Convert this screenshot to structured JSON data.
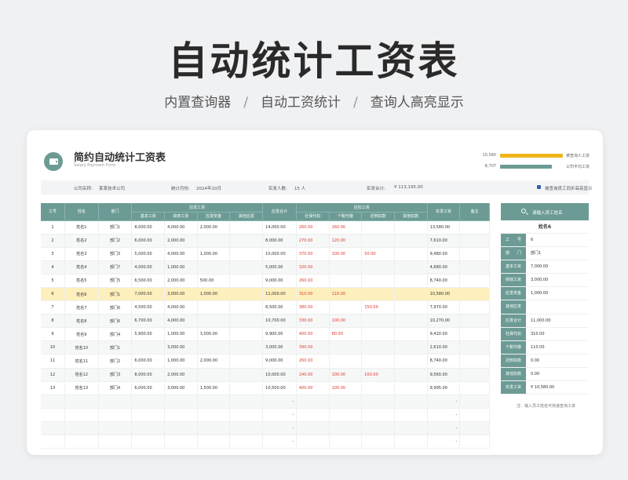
{
  "hero": {
    "title": "自动统计工资表",
    "sub": [
      "内置查询器",
      "/",
      "自动工资统计",
      "/",
      "查询人高亮显示"
    ]
  },
  "form": {
    "title": "简约自动统计工资表",
    "subtitle": "Salary Payment Form"
  },
  "mini_chart": {
    "bars": [
      {
        "value": "10,580",
        "label": "被查询人工资",
        "color": "#f0b51d",
        "fraction": 1.0
      },
      {
        "value": "8,707",
        "label": "公司平均工资",
        "color": "#6c9b95",
        "fraction": 0.82
      }
    ]
  },
  "info": {
    "company_label": "公司名称:",
    "company": "某某技术公司",
    "month_label": "统计月份:",
    "month": "2024年10月",
    "people_label": "实发人数:",
    "people": "15 人",
    "total_label": "实发合计:",
    "total": "¥ 113,195.00",
    "highlight_label": "被查询员工同步高亮显示"
  },
  "table": {
    "headers": {
      "id": "工号",
      "name": "姓名",
      "dept": "部门",
      "pay_group": "应发工资",
      "basic": "基本工资",
      "perf": "绩效工资",
      "bonus": "应发奖金",
      "other_pay": "其他应发",
      "total_pay": "应发合计",
      "deduct_group": "应扣工资",
      "social": "社保代扣",
      "tax": "个税代缴",
      "late": "迟到扣款",
      "other_deduct": "其他扣款",
      "net": "实发工资",
      "remark": "备注"
    },
    "rows": [
      {
        "id": "1",
        "name": "姓名1",
        "dept": "部门1",
        "basic": "8,000.00",
        "perf": "4,000.00",
        "bonus": "2,000.00",
        "other": "",
        "total": "14,000.00",
        "social": "260.00",
        "tax": "160.00",
        "late": "",
        "od": "",
        "net": "13,580.00",
        "remark": ""
      },
      {
        "id": "2",
        "name": "姓名2",
        "dept": "部门2",
        "basic": "6,000.00",
        "perf": "2,000.00",
        "bonus": "",
        "other": "",
        "total": "8,000.00",
        "social": "270.00",
        "tax": "120.00",
        "late": "",
        "od": "",
        "net": "7,610.00",
        "remark": ""
      },
      {
        "id": "3",
        "name": "姓名3",
        "dept": "部门3",
        "basic": "5,000.00",
        "perf": "4,000.00",
        "bonus": "1,000.00",
        "other": "",
        "total": "10,000.00",
        "social": "370.00",
        "tax": "100.00",
        "late": "50.00",
        "od": "",
        "net": "9,480.00",
        "remark": ""
      },
      {
        "id": "4",
        "name": "姓名4",
        "dept": "部门7",
        "basic": "4,000.00",
        "perf": "1,000.00",
        "bonus": "",
        "other": "",
        "total": "5,000.00",
        "social": "320.00",
        "tax": "",
        "late": "",
        "od": "",
        "net": "4,680.00",
        "remark": ""
      },
      {
        "id": "5",
        "name": "姓名5",
        "dept": "部门5",
        "basic": "6,500.00",
        "perf": "2,000.00",
        "bonus": "500.00",
        "other": "",
        "total": "9,000.00",
        "social": "260.00",
        "tax": "",
        "late": "",
        "od": "",
        "net": "8,740.00",
        "remark": ""
      },
      {
        "id": "6",
        "name": "姓名6",
        "dept": "部门1",
        "basic": "7,000.00",
        "perf": "3,000.00",
        "bonus": "1,000.00",
        "other": "",
        "total": "11,000.00",
        "social": "310.00",
        "tax": "110.00",
        "late": "",
        "od": "",
        "net": "10,580.00",
        "remark": ""
      },
      {
        "id": "7",
        "name": "姓名7",
        "dept": "部门6",
        "basic": "4,500.00",
        "perf": "4,000.00",
        "bonus": "",
        "other": "",
        "total": "8,500.00",
        "social": "380.00",
        "tax": "",
        "late": "150.00",
        "od": "",
        "net": "7,970.00",
        "remark": ""
      },
      {
        "id": "8",
        "name": "姓名8",
        "dept": "部门6",
        "basic": "6,700.00",
        "perf": "4,000.00",
        "bonus": "",
        "other": "",
        "total": "10,700.00",
        "social": "330.00",
        "tax": "100.00",
        "late": "",
        "od": "",
        "net": "10,270.00",
        "remark": ""
      },
      {
        "id": "9",
        "name": "姓名9",
        "dept": "部门4",
        "basic": "5,900.00",
        "perf": "1,000.00",
        "bonus": "3,000.00",
        "other": "",
        "total": "9,900.00",
        "social": "400.00",
        "tax": "80.00",
        "late": "",
        "od": "",
        "net": "9,420.00",
        "remark": ""
      },
      {
        "id": "10",
        "name": "姓名10",
        "dept": "部门1",
        "basic": "",
        "perf": "3,000.00",
        "bonus": "",
        "other": "",
        "total": "3,000.00",
        "social": "390.00",
        "tax": "",
        "late": "",
        "od": "",
        "net": "2,610.00",
        "remark": ""
      },
      {
        "id": "11",
        "name": "姓名11",
        "dept": "部门2",
        "basic": "6,000.00",
        "perf": "1,000.00",
        "bonus": "2,000.00",
        "other": "",
        "total": "9,000.00",
        "social": "260.00",
        "tax": "",
        "late": "",
        "od": "",
        "net": "8,740.00",
        "remark": ""
      },
      {
        "id": "12",
        "name": "姓名12",
        "dept": "部门3",
        "basic": "8,000.00",
        "perf": "2,000.00",
        "bonus": "",
        "other": "",
        "total": "10,000.00",
        "social": "240.00",
        "tax": "100.00",
        "late": "100.00",
        "od": "",
        "net": "9,560.00",
        "remark": ""
      },
      {
        "id": "13",
        "name": "姓名13",
        "dept": "部门4",
        "basic": "6,000.00",
        "perf": "3,000.00",
        "bonus": "1,500.00",
        "other": "",
        "total": "10,500.00",
        "social": "400.00",
        "tax": "100.00",
        "late": "",
        "od": "",
        "net": "9,995.00",
        "remark": ""
      },
      {
        "id": "",
        "name": "",
        "dept": "",
        "basic": "",
        "perf": "",
        "bonus": "",
        "other": "",
        "total": "-",
        "social": "",
        "tax": "",
        "late": "",
        "od": "",
        "net": "-",
        "remark": ""
      },
      {
        "id": "",
        "name": "",
        "dept": "",
        "basic": "",
        "perf": "",
        "bonus": "",
        "other": "",
        "total": "-",
        "social": "",
        "tax": "",
        "late": "",
        "od": "",
        "net": "-",
        "remark": ""
      },
      {
        "id": "",
        "name": "",
        "dept": "",
        "basic": "",
        "perf": "",
        "bonus": "",
        "other": "",
        "total": "-",
        "social": "",
        "tax": "",
        "late": "",
        "od": "",
        "net": "-",
        "remark": ""
      },
      {
        "id": "",
        "name": "",
        "dept": "",
        "basic": "",
        "perf": "",
        "bonus": "",
        "other": "",
        "total": "-",
        "social": "",
        "tax": "",
        "late": "",
        "od": "",
        "net": "-",
        "remark": ""
      }
    ],
    "highlight_row": 5
  },
  "side": {
    "search_placeholder": "请输入员工姓名",
    "name": "姓名6",
    "rows": [
      {
        "k": "工　　号",
        "v": "6"
      },
      {
        "k": "部　　门",
        "v": "部门1"
      },
      {
        "k": "基本工资",
        "v": "7,000.00"
      },
      {
        "k": "绩效工资",
        "v": "3,000.00"
      },
      {
        "k": "应发奖金",
        "v": "1,000.00"
      },
      {
        "k": "其他应发",
        "v": ""
      },
      {
        "k": "应发合计",
        "v": "11,000.00"
      },
      {
        "k": "社保代扣",
        "v": "310.00"
      },
      {
        "k": "个税代缴",
        "v": "110.00"
      },
      {
        "k": "迟到扣款",
        "v": "0.00"
      },
      {
        "k": "其他扣款",
        "v": "0.00"
      },
      {
        "k": "实发工资",
        "v": "¥ 10,580.00"
      }
    ],
    "note": "注：输入员工姓名可快速查询工资"
  }
}
